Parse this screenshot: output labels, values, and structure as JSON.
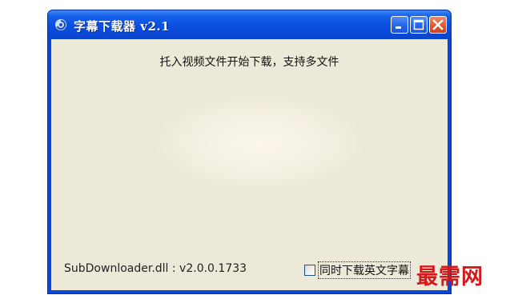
{
  "window": {
    "title": "字幕下载器  v2.1",
    "icon": "app-swirl-icon",
    "controls": {
      "minimize": "minimize-icon",
      "maximize": "maximize-icon",
      "close": "close-icon"
    }
  },
  "main": {
    "instruction": "托入视频文件开始下载，支持多文件",
    "version_text": "SubDownloader.dll : v2.0.0.1733",
    "english_subtitle_checkbox": {
      "label": "同时下载英文字幕",
      "checked": false
    }
  },
  "watermark": "最需网",
  "colors": {
    "titlebar": "#0a4fe0",
    "client_bg": "#ece9d8",
    "close_button": "#e0552e",
    "watermark": "#d21a1a"
  }
}
